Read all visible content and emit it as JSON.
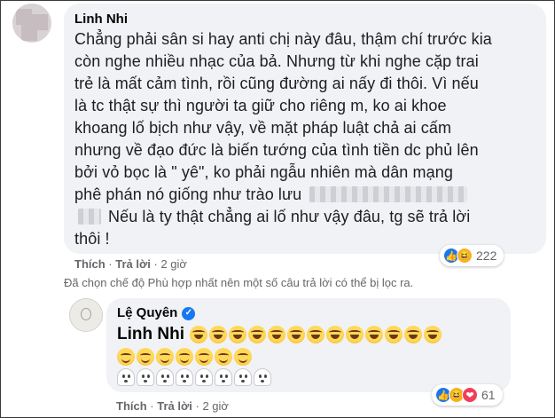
{
  "colors": {
    "bubble_bg": "#f0f2f5",
    "meta_text": "#65676b",
    "like_blue": "#1877f2",
    "love_red": "#f33e58",
    "haha_yellow": "#f7b125"
  },
  "comment": {
    "author": "Linh Nhi",
    "lines": [
      "Chẳng phải sân si hay anti chị này đâu, thậm chí trước kia",
      "còn nghe nhiều nhạc của bả. Nhưng từ khi nghe cặp trai",
      "trẻ là mất cảm tình, rồi cũng đường ai nấy đi thôi. Vì nếu",
      "là tc thật sự thì người ta giữ cho riêng m, ko ai khoe",
      "khoang lố bịch như vậy, về mặt pháp luật chả ai cấm",
      "nhưng về đạo đức là biến tướng của tình tiền dc phủ lên",
      "bởi vỏ bọc là \" yê\", ko phải ngẫu nhiên mà dân mạng",
      "phê phán nó giống như trào lưu",
      "Nếu là ty thật chẳng ai lố như vậy đâu, tg sẽ trả lời",
      "thôi !"
    ],
    "like_label": "Thích",
    "reply_label": "Trả lời",
    "time": "2 giờ",
    "separator": "·",
    "reaction_icons": [
      "like-icon",
      "haha-icon"
    ],
    "reaction_count": "222"
  },
  "filter_notice": "Đã chọn chế độ Phù hợp nhất nên một số câu trả lời có thể bị lọc ra.",
  "reply": {
    "author": "Lệ Quyên",
    "verified_icon": "verified-badge-icon",
    "tagged_name": "Linh Nhi",
    "emoji_rows": [
      {
        "type": "laughing-emoji",
        "count": 13
      },
      {
        "type": "grinning-emoji",
        "count": 7
      },
      {
        "type": "ghost-emoji",
        "count": 8
      }
    ],
    "like_label": "Thích",
    "reply_label": "Trả lời",
    "time": "2 giờ",
    "separator": "·",
    "reaction_icons": [
      "like-icon",
      "haha-icon",
      "love-icon"
    ],
    "reaction_count": "61"
  }
}
